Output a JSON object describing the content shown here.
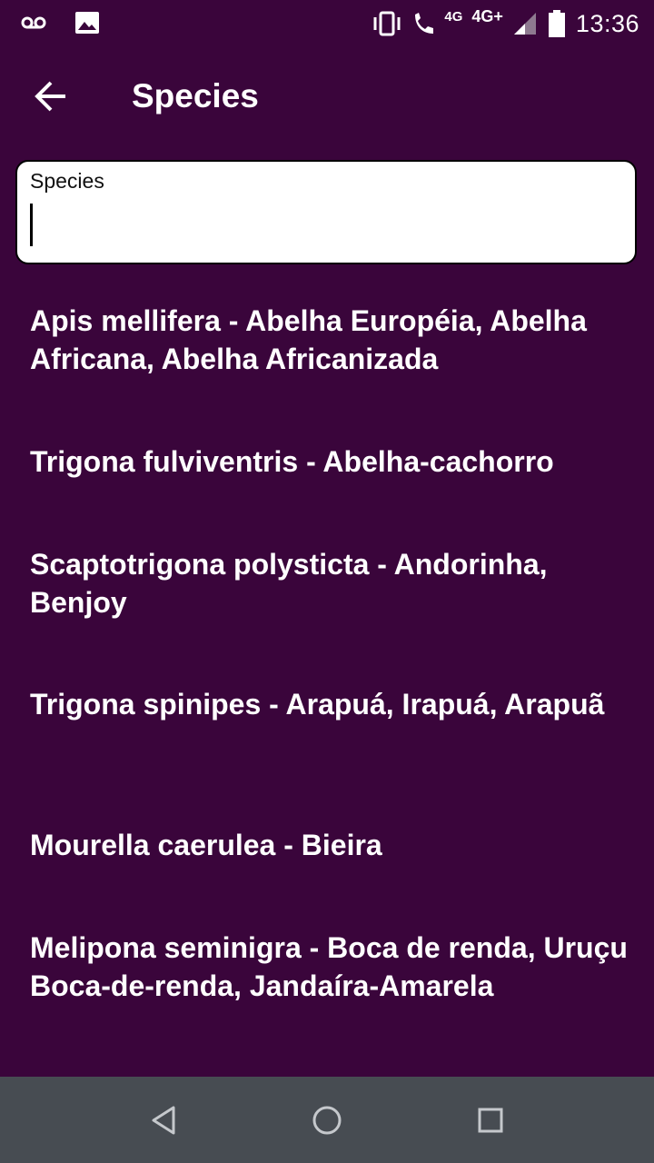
{
  "status_bar": {
    "time": "13:36",
    "network_small": "4G",
    "network": "4G+",
    "icons": [
      "voicemail-icon",
      "image-icon",
      "vibrate-icon",
      "wifi-calling-icon",
      "signal-icon",
      "battery-icon"
    ]
  },
  "app_bar": {
    "title": "Species",
    "back_icon": "arrow-left-icon"
  },
  "search": {
    "label": "Species",
    "value": ""
  },
  "species": [
    "Apis mellifera - Abelha Européia, Abelha Africana, Abelha Africanizada",
    "Trigona fulviventris - Abelha-cachorro",
    "Scaptotrigona polysticta - Andorinha, Benjoy",
    "Trigona spinipes - Arapuá, Irapuá, Arapuã",
    "Mourella caerulea - Bieira",
    "Melipona seminigra - Boca de renda, Uruçu Boca-de-renda, Jandaíra-Amarela"
  ],
  "nav_bar": {
    "icons": [
      "back-triangle-icon",
      "home-circle-icon",
      "recents-square-icon"
    ]
  },
  "colors": {
    "background": "#3a053b",
    "nav_bar": "#474c52",
    "text": "#ffffff"
  }
}
